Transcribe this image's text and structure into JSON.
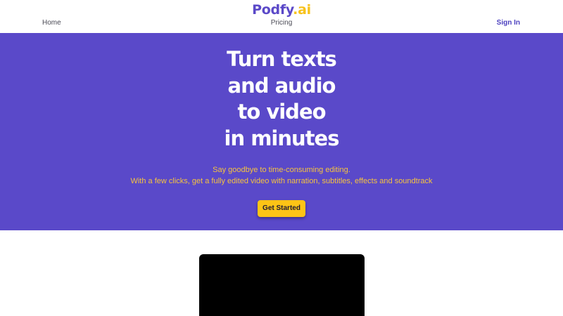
{
  "logo": {
    "brand": "Podfy",
    "tld": ".ai"
  },
  "nav": {
    "home": "Home",
    "pricing": "Pricing",
    "signin": "Sign In"
  },
  "hero": {
    "title_lines": [
      "Turn texts",
      "and audio",
      "to video",
      "in minutes"
    ],
    "subtitle_lines": [
      "Say goodbye to time-consuming editing.",
      "With a few clicks, get a fully edited video with narration, subtitles, effects and soundtrack"
    ],
    "cta_label": "Get Started"
  },
  "colors": {
    "brand_purple": "#5a49c9",
    "accent_yellow": "#fdc416",
    "subtitle_yellow": "#f6c33e",
    "background": "#ffffff",
    "video_black": "#000000"
  }
}
